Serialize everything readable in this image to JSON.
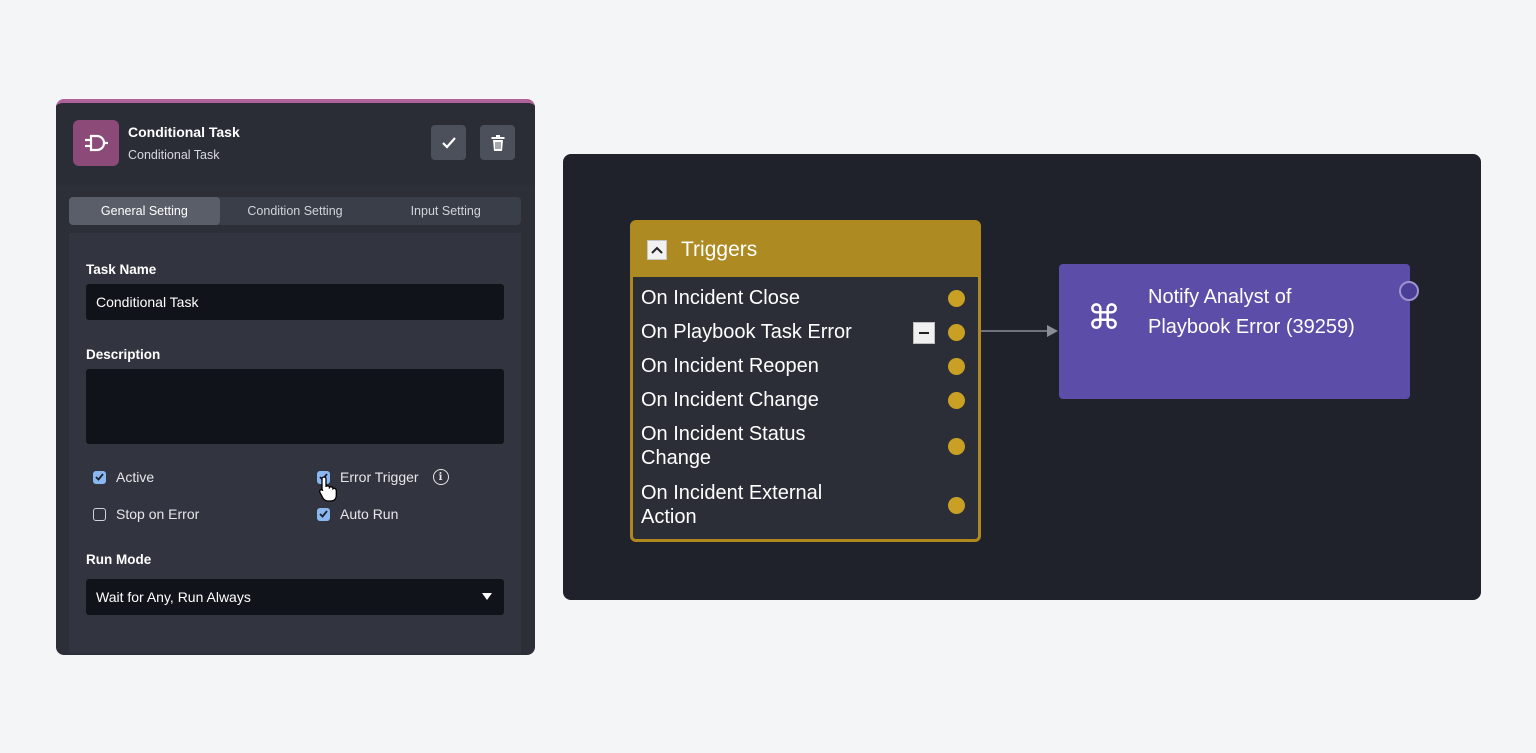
{
  "task": {
    "title": "Conditional Task",
    "subtitle": "Conditional Task"
  },
  "tabs": [
    {
      "label": "General Setting",
      "active": true
    },
    {
      "label": "Condition Setting",
      "active": false
    },
    {
      "label": "Input Setting",
      "active": false
    }
  ],
  "form": {
    "task_name_label": "Task Name",
    "task_name_value": "Conditional Task",
    "description_label": "Description",
    "description_value": "",
    "checkboxes": {
      "active": {
        "label": "Active",
        "checked": true
      },
      "error_trigger": {
        "label": "Error Trigger",
        "checked": true
      },
      "stop_on_error": {
        "label": "Stop on Error",
        "checked": false
      },
      "auto_run": {
        "label": "Auto Run",
        "checked": true
      }
    },
    "run_mode_label": "Run Mode",
    "run_mode_value": "Wait for Any, Run Always"
  },
  "canvas": {
    "trigger_node": {
      "title": "Triggers",
      "items": [
        "On Incident Close",
        "On Playbook Task Error",
        "On Incident Reopen",
        "On Incident Change",
        "On Incident Status Change",
        "On Incident External Action"
      ]
    },
    "action_node": {
      "title": "Notify Analyst of Playbook Error (39259)"
    }
  },
  "colors": {
    "panel_accent": "#b0639a",
    "task_icon_bg": "#8b4a78",
    "trigger_gold": "#ad8a22",
    "action_purple": "#5b4da8",
    "checkbox_blue": "#8ab7f0"
  },
  "icons": {
    "task": "logic-gate-icon",
    "confirm": "check-icon",
    "delete": "trash-icon",
    "collapse": "chevron-up-icon",
    "remove": "minus-icon",
    "action": "command-icon",
    "info": "info-icon"
  }
}
